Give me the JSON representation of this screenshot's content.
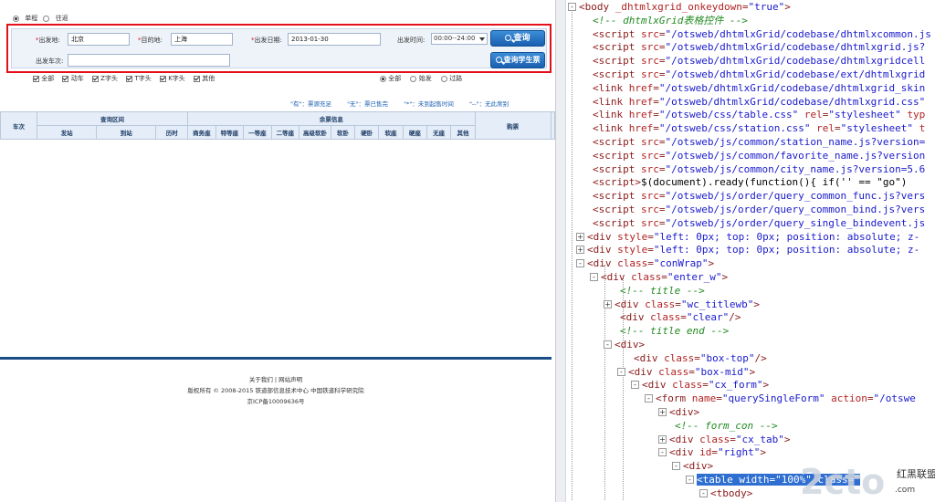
{
  "trip_type": {
    "options": [
      "单程",
      "往返"
    ],
    "selected": 0
  },
  "form": {
    "from_label": "出发地:",
    "from_value": "北京",
    "to_label": "目的地:",
    "to_value": "上海",
    "date_label": "出发日期:",
    "date_value": "2013-01-30",
    "time_label": "出发时间:",
    "time_value": "00:00--24:00",
    "train_label": "出发车次:",
    "train_value": "",
    "query_button": "查询",
    "student_button": "查询学生票"
  },
  "train_filters": [
    "全部",
    "动车",
    "Z字头",
    "T字头",
    "K字头",
    "其他"
  ],
  "station_filters": {
    "options": [
      "全部",
      "始发",
      "过路"
    ],
    "selected": 0
  },
  "legend": [
    "\"有\"：票源充足",
    "\"无\"：票已售完",
    "\"*\"：未到起售时间",
    "\"--\"：无此席别"
  ],
  "grid": {
    "train_no": "车次",
    "interval": "查询区间",
    "seats_group": "余票信息",
    "buy": "购票",
    "sub_headers": [
      "发站",
      "到站",
      "历时"
    ],
    "seat_types": [
      "商务座",
      "特等座",
      "一等座",
      "二等座",
      "高级软卧",
      "软卧",
      "硬卧",
      "软座",
      "硬座",
      "无座",
      "其他"
    ]
  },
  "footer": {
    "links": [
      "关于我们",
      "网站声明"
    ],
    "copyright": "版权所有 © 2008-2015 铁道部信息技术中心  中国铁道科学研究院",
    "icp": "京ICP备10009636号"
  },
  "devtools": {
    "lines": [
      {
        "indent": 0,
        "exp": "-",
        "html": "<span class='tag'>&lt;body</span> <span class='attr'>_dhtmlxgrid_onkeydown</span>=<span class='val'>\"true\"</span><span class='tag'>&gt;</span>"
      },
      {
        "indent": 1,
        "exp": "",
        "html": "<span class='cmt'>&lt;!--  dhtmlxGrid表格控件  --&gt;</span>"
      },
      {
        "indent": 1,
        "exp": "",
        "html": "<span class='tag'>&lt;script</span> <span class='attr'>src</span>=<span class='val'>\"/otsweb/dhtmlxGrid/codebase/dhtmlxcommon.js</span>"
      },
      {
        "indent": 1,
        "exp": "",
        "html": "<span class='tag'>&lt;script</span> <span class='attr'>src</span>=<span class='val'>\"/otsweb/dhtmlxGrid/codebase/dhtmlxgrid.js?</span>"
      },
      {
        "indent": 1,
        "exp": "",
        "html": "<span class='tag'>&lt;script</span> <span class='attr'>src</span>=<span class='val'>\"/otsweb/dhtmlxGrid/codebase/dhtmlxgridcell</span>"
      },
      {
        "indent": 1,
        "exp": "",
        "html": "<span class='tag'>&lt;script</span> <span class='attr'>src</span>=<span class='val'>\"/otsweb/dhtmlxGrid/codebase/ext/dhtmlxgrid</span>"
      },
      {
        "indent": 1,
        "exp": "",
        "html": "<span class='tag'>&lt;link</span> <span class='attr'>href</span>=<span class='val'>\"/otsweb/dhtmlxGrid/codebase/dhtmlxgrid_skin</span>"
      },
      {
        "indent": 1,
        "exp": "",
        "html": "<span class='tag'>&lt;link</span> <span class='attr'>href</span>=<span class='val'>\"/otsweb/dhtmlxGrid/codebase/dhtmlxgrid.css\"</span>"
      },
      {
        "indent": 1,
        "exp": "",
        "html": "<span class='tag'>&lt;link</span> <span class='attr'>href</span>=<span class='val'>\"/otsweb/css/table.css\"</span> <span class='attr'>rel</span>=<span class='val'>\"stylesheet\"</span> <span class='attr'>typ</span>"
      },
      {
        "indent": 1,
        "exp": "",
        "html": "<span class='tag'>&lt;link</span> <span class='attr'>href</span>=<span class='val'>\"/otsweb/css/station.css\"</span> <span class='attr'>rel</span>=<span class='val'>\"stylesheet\"</span> <span class='attr'>t</span>"
      },
      {
        "indent": 1,
        "exp": "",
        "html": "<span class='tag'>&lt;script</span> <span class='attr'>src</span>=<span class='val'>\"/otsweb/js/common/station_name.js?version=</span>"
      },
      {
        "indent": 1,
        "exp": "",
        "html": "<span class='tag'>&lt;script</span> <span class='attr'>src</span>=<span class='val'>\"/otsweb/js/common/favorite_name.js?version</span>"
      },
      {
        "indent": 1,
        "exp": "",
        "html": "<span class='tag'>&lt;script</span> <span class='attr'>src</span>=<span class='val'>\"/otsweb/js/common/city_name.js?version=5.6</span>"
      },
      {
        "indent": 1,
        "exp": "",
        "html": "<span class='tag'>&lt;script&gt;</span><span class='txt'>$(document).ready(function(){   if('' == \"go\")</span>"
      },
      {
        "indent": 1,
        "exp": "",
        "html": "<span class='tag'>&lt;script</span> <span class='attr'>src</span>=<span class='val'>\"/otsweb/js/order/query_common_func.js?vers</span>"
      },
      {
        "indent": 1,
        "exp": "",
        "html": "<span class='tag'>&lt;script</span> <span class='attr'>src</span>=<span class='val'>\"/otsweb/js/order/query_common_bind.js?vers</span>"
      },
      {
        "indent": 1,
        "exp": "",
        "html": "<span class='tag'>&lt;script</span> <span class='attr'>src</span>=<span class='val'>\"/otsweb/js/order/query_single_bindevent.js</span>"
      },
      {
        "indent": 0.6,
        "exp": "+",
        "html": "<span class='tag'>&lt;div</span> <span class='attr'>style</span>=<span class='val'>\"left: 0px; top: 0px; position: absolute; z-</span>"
      },
      {
        "indent": 0.6,
        "exp": "+",
        "html": "<span class='tag'>&lt;div</span> <span class='attr'>style</span>=<span class='val'>\"left: 0px; top: 0px; position: absolute; z-</span>"
      },
      {
        "indent": 0.6,
        "exp": "-",
        "html": "<span class='tag'>&lt;div</span> <span class='attr'>class</span>=<span class='val'>\"conWrap\"</span><span class='tag'>&gt;</span>"
      },
      {
        "indent": 1.6,
        "exp": "-",
        "html": "<span class='tag'>&lt;div</span> <span class='attr'>class</span>=<span class='val'>\"enter_w\"</span><span class='tag'>&gt;</span>"
      },
      {
        "indent": 3,
        "exp": "",
        "html": "<span class='cmt'>&lt;!-- title  --&gt;</span>"
      },
      {
        "indent": 2.6,
        "exp": "+",
        "html": "<span class='tag'>&lt;div</span> <span class='attr'>class</span>=<span class='val'>\"wc_titlewb\"</span><span class='tag'>&gt;</span>"
      },
      {
        "indent": 3,
        "exp": "",
        "html": "<span class='tag'>&lt;div</span> <span class='attr'>class</span>=<span class='val'>\"clear\"</span><span class='tag'>/&gt;</span>"
      },
      {
        "indent": 3,
        "exp": "",
        "html": "<span class='cmt'>&lt;!-- title end --&gt;</span>"
      },
      {
        "indent": 2.6,
        "exp": "-",
        "html": "<span class='tag'>&lt;div&gt;</span>"
      },
      {
        "indent": 4,
        "exp": "",
        "html": "<span class='tag'>&lt;div</span> <span class='attr'>class</span>=<span class='val'>\"box-top\"</span><span class='tag'>/&gt;</span>"
      },
      {
        "indent": 3.6,
        "exp": "-",
        "html": "<span class='tag'>&lt;div</span> <span class='attr'>class</span>=<span class='val'>\"box-mid\"</span><span class='tag'>&gt;</span>"
      },
      {
        "indent": 4.6,
        "exp": "-",
        "html": "<span class='tag'>&lt;div</span> <span class='attr'>class</span>=<span class='val'>\"cx_form\"</span><span class='tag'>&gt;</span>"
      },
      {
        "indent": 5.6,
        "exp": "-",
        "html": "<span class='tag'>&lt;form</span> <span class='attr'>name</span>=<span class='val'>\"querySingleForm\"</span> <span class='attr'>action</span>=<span class='val'>\"/otswe</span>"
      },
      {
        "indent": 6.6,
        "exp": "+",
        "html": "<span class='tag'>&lt;div&gt;</span>"
      },
      {
        "indent": 7,
        "exp": "",
        "html": "<span class='cmt'>&lt;!-- form_con --&gt;</span>"
      },
      {
        "indent": 6.6,
        "exp": "+",
        "html": "<span class='tag'>&lt;div</span> <span class='attr'>class</span>=<span class='val'>\"cx_tab\"</span><span class='tag'>&gt;</span>"
      },
      {
        "indent": 6.6,
        "exp": "-",
        "html": "<span class='tag'>&lt;div</span> <span class='attr'>id</span>=<span class='val'>\"right\"</span><span class='tag'>&gt;</span>"
      },
      {
        "indent": 7.6,
        "exp": "-",
        "html": "<span class='tag'>&lt;div&gt;</span>"
      },
      {
        "indent": 8.6,
        "exp": "-",
        "html": "<span class='hl'>&lt;table width=\"100%\" class=\"</span>"
      },
      {
        "indent": 9.6,
        "exp": "-",
        "html": "<span class='tag'>&lt;tbody&gt;</span>"
      }
    ]
  },
  "watermark": "2cto.com"
}
